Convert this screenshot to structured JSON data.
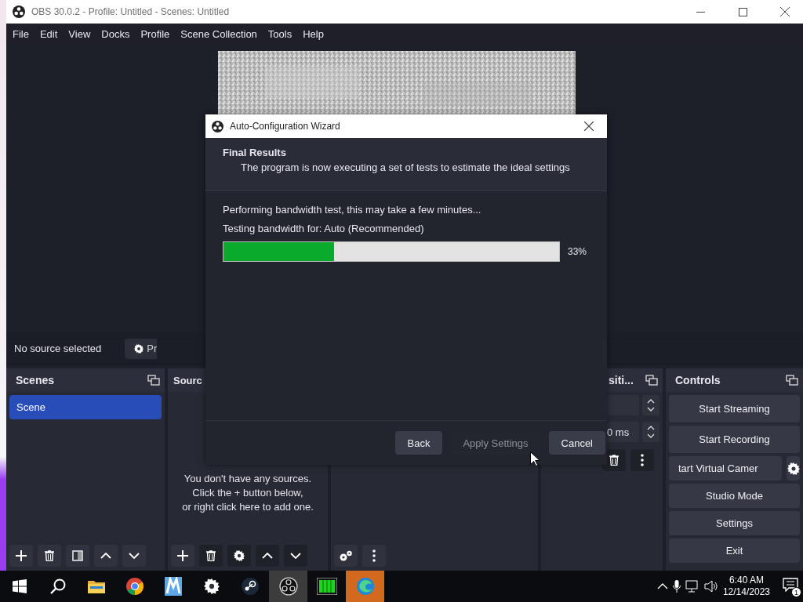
{
  "window": {
    "title": "OBS 30.0.2 - Profile: Untitled - Scenes: Untitled"
  },
  "menu": [
    {
      "label": "File"
    },
    {
      "label": "Edit"
    },
    {
      "label": "View"
    },
    {
      "label": "Docks"
    },
    {
      "label": "Profile"
    },
    {
      "label": "Scene Collection"
    },
    {
      "label": "Tools"
    },
    {
      "label": "Help"
    }
  ],
  "source_bar": {
    "label": "No source selected",
    "properties_button": "Pr"
  },
  "scenes": {
    "title": "Scenes",
    "items": [
      {
        "name": "Scene",
        "selected": true
      }
    ]
  },
  "sources": {
    "title": "Sourc",
    "empty_message": [
      "You don't have any sources.",
      "Click the + button below,",
      "or right click here to add one."
    ]
  },
  "transitions": {
    "title": "siti...",
    "duration": "0 ms"
  },
  "controls": {
    "title": "Controls",
    "buttons": [
      {
        "label": "Start Streaming",
        "kind": "full"
      },
      {
        "label": "Start Recording",
        "kind": "full"
      },
      {
        "label": "tart Virtual Camer",
        "kind": "with-settings"
      },
      {
        "label": "Studio Mode",
        "kind": "full"
      },
      {
        "label": "Settings",
        "kind": "full"
      },
      {
        "label": "Exit",
        "kind": "full"
      }
    ]
  },
  "dialog": {
    "title": "Auto-Configuration Wizard",
    "heading": "Final Results",
    "subheading": "The program is now executing a set of tests to estimate the ideal settings",
    "status": "Performing bandwidth test, this may take a few minutes...",
    "testing": "Testing bandwidth for: Auto (Recommended)",
    "progress": {
      "level": 0.33,
      "reading": "33%"
    },
    "buttons": [
      {
        "label": "Back",
        "disabled": false
      },
      {
        "label": "Apply Settings",
        "disabled": true
      },
      {
        "label": "Cancel",
        "disabled": false
      }
    ]
  },
  "taskbar": {
    "time": "6:40 AM",
    "date": "12/14/2023",
    "notifications": "1"
  }
}
